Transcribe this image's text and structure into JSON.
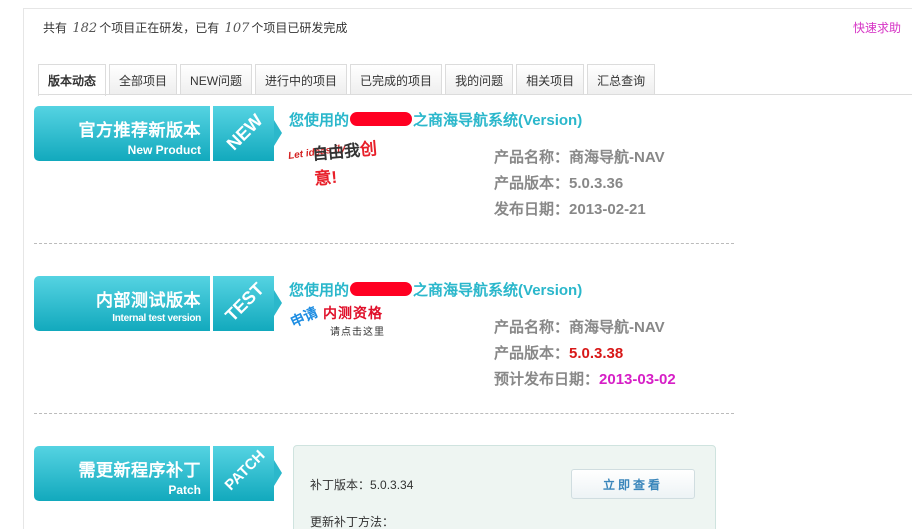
{
  "header": {
    "count_prefix": "共有",
    "in_dev_count": "182",
    "in_dev_suffix": "个项目正在研发，已有",
    "done_count": "107",
    "done_suffix": "个项目已研发完成",
    "quick_help": "快速求助"
  },
  "tabs": [
    {
      "label": "版本动态",
      "active": true
    },
    {
      "label": "全部项目",
      "active": false
    },
    {
      "label": "NEW问题",
      "active": false
    },
    {
      "label": "进行中的项目",
      "active": false
    },
    {
      "label": "已完成的项目",
      "active": false
    },
    {
      "label": "我的问题",
      "active": false
    },
    {
      "label": "相关项目",
      "active": false
    },
    {
      "label": "汇总查询",
      "active": false
    }
  ],
  "sections": {
    "official": {
      "banner_zh": "官方推荐新版本",
      "banner_en": "New Product",
      "banner_tag": "NEW",
      "title_prefix": "您使用的",
      "title_suffix": "之商海导航系统(Version)",
      "slogan_let": "Let ideas fly",
      "slogan_text": "自由我",
      "slogan_emph": "创意!",
      "name_label": "产品名称：",
      "name_value": "商海导航-NAV",
      "version_label": "产品版本：",
      "version_value": "5.0.3.36",
      "date_label": "发布日期：",
      "date_value": "2013-02-21"
    },
    "internal": {
      "banner_zh": "内部测试版本",
      "banner_en": "Internal test version",
      "banner_tag": "TEST",
      "title_prefix": "您使用的",
      "title_suffix": "之商海导航系统(Version)",
      "apply_1": "申请",
      "apply_2": "内测资格",
      "apply_3": "请点击这里",
      "name_label": "产品名称：",
      "name_value": "商海导航-NAV",
      "version_label": "产品版本：",
      "version_value": "5.0.3.38",
      "date_label": "预计发布日期：",
      "date_value": "2013-03-02"
    },
    "patch": {
      "banner_zh": "需更新程序补丁",
      "banner_en": "Patch",
      "banner_tag": "PATCH",
      "patch_version_label": "补丁版本：",
      "patch_version_value": "5.0.3.34",
      "view_button": "立即查看",
      "method_label": "更新补丁方法："
    }
  },
  "colors": {
    "accent_cyan": "#2ab7cb",
    "red": "#d81818",
    "magenta": "#d61fc6",
    "help_link": "#d633c5"
  }
}
